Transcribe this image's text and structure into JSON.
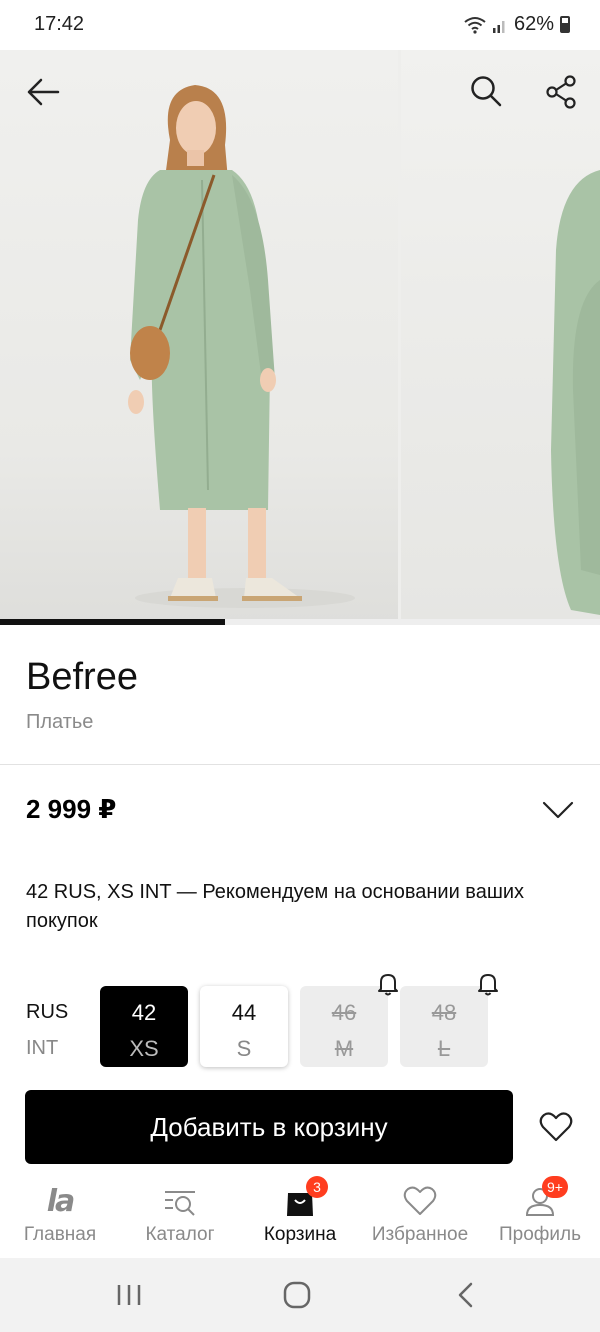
{
  "status_bar": {
    "time": "17:42",
    "battery": "62%"
  },
  "gallery": {
    "progress": 0.375
  },
  "product": {
    "brand": "Befree",
    "type": "Платье",
    "price": "2 999 ₽",
    "recommendation": "42 RUS, XS INT — Рекомендуем на основании ваших покупок"
  },
  "sizes": {
    "row_label_rus": "RUS",
    "row_label_int": "INT",
    "items": [
      {
        "rus": "42",
        "int": "XS",
        "state": "selected"
      },
      {
        "rus": "44",
        "int": "S",
        "state": "available"
      },
      {
        "rus": "46",
        "int": "M",
        "state": "unavailable"
      },
      {
        "rus": "48",
        "int": "L",
        "state": "unavailable"
      }
    ]
  },
  "actions": {
    "add_to_cart": "Добавить в корзину"
  },
  "bottom_nav": {
    "items": [
      {
        "label": "Главная",
        "icon": "lamoda-logo-icon",
        "active": false
      },
      {
        "label": "Каталог",
        "icon": "catalog-icon",
        "active": false
      },
      {
        "label": "Корзина",
        "icon": "shopping-bag-icon",
        "active": true,
        "badge": "3"
      },
      {
        "label": "Избранное",
        "icon": "heart-icon",
        "active": false
      },
      {
        "label": "Профиль",
        "icon": "profile-icon",
        "active": false,
        "badge": "9+"
      }
    ]
  },
  "colors": {
    "accent_badge": "#ff3d1f",
    "primary_button": "#000000",
    "dress": "#a9c3a6"
  }
}
